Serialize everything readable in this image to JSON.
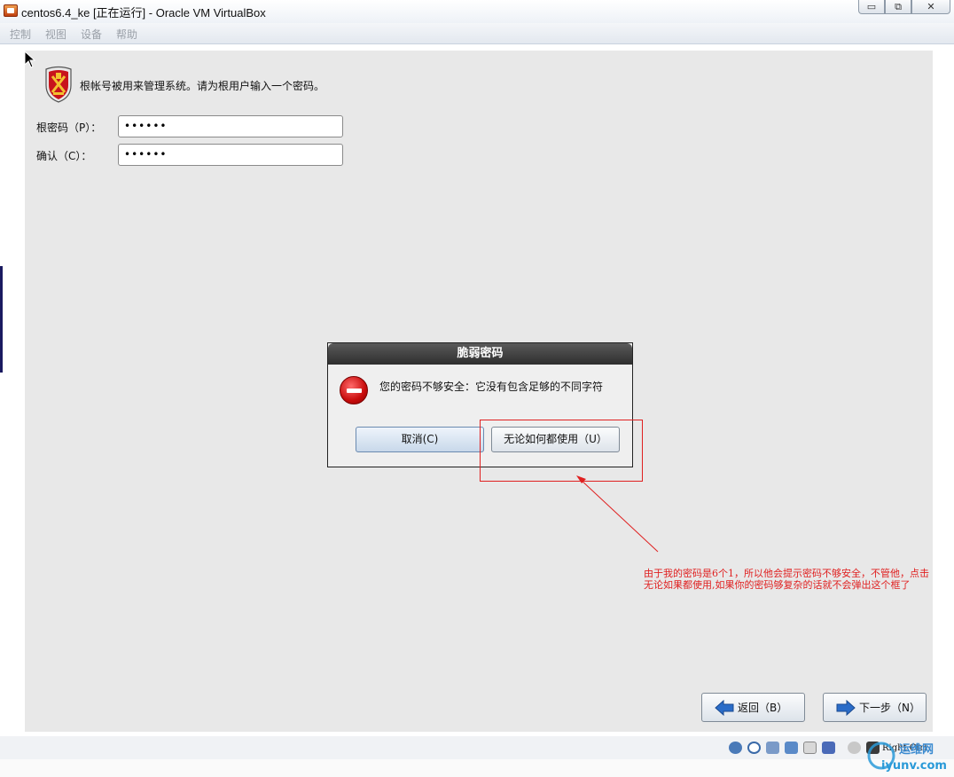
{
  "window": {
    "title": "centos6.4_ke [正在运行] - Oracle VM VirtualBox",
    "minimize_glyph": "▭",
    "restore_glyph": "⧉",
    "close_glyph": "✕"
  },
  "menubar": {
    "items": [
      "控制",
      "视图",
      "设备",
      "帮助"
    ]
  },
  "installer": {
    "header_text": "根帐号被用来管理系统。请为根用户输入一个密码。",
    "root_password_label": "根密码（P）：",
    "root_password_value": "••••••",
    "confirm_label": "确认（C）：",
    "confirm_value": "••••••",
    "back_label": "返回（B）",
    "next_label": "下一步（N）"
  },
  "dialog": {
    "title": "脆弱密码",
    "message": "您的密码不够安全：它没有包含足够的不同字符",
    "cancel_label": "取消(C)",
    "use_anyway_label": "无论如何都使用（U）"
  },
  "annotation": {
    "text_line1": "由于我的密码是6个1，所以他会提示密码不够安全，不管他，点击",
    "text_line2": "无论如果都使用,如果你的密码够复杂的话就不会弹出这个框了"
  },
  "statusbar": {
    "host_key": "Right Ctrl"
  },
  "watermark": {
    "cn": "运维网",
    "url": "iyunv.com"
  },
  "colors": {
    "annotation": "#e02020",
    "guest_background": "#e8e8e8",
    "dialog_title": "#3a3a3a"
  }
}
